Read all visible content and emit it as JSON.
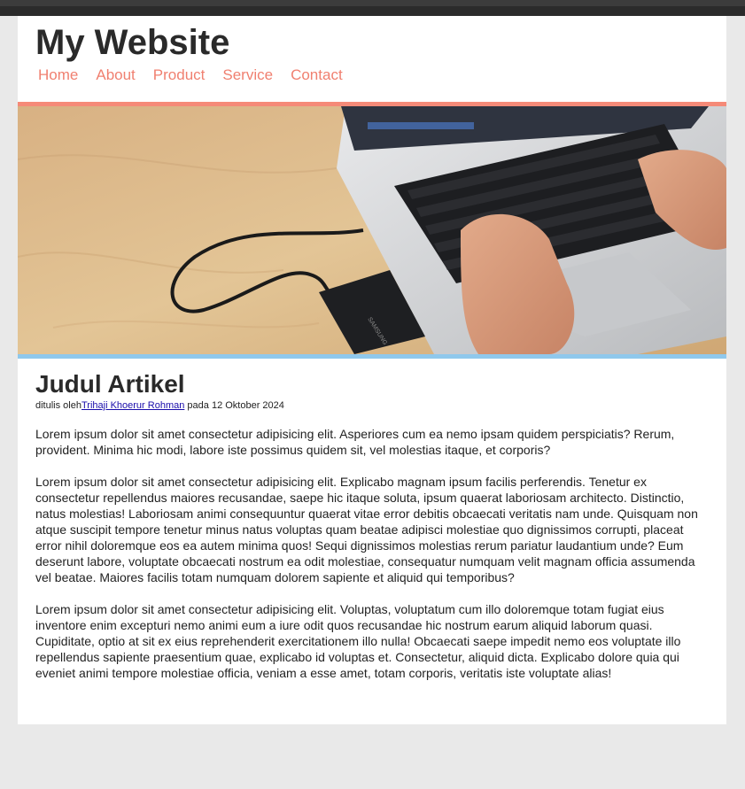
{
  "site": {
    "title": "My Website",
    "nav": [
      "Home",
      "About",
      "Product",
      "Service",
      "Contact"
    ]
  },
  "hero": {
    "image_alt": "Laptop with external drive on wooden desk",
    "device_label": "SAMSUNG"
  },
  "article": {
    "title": "Judul Artikel",
    "byline_prefix": "ditulis oleh",
    "author": "Trihaji Khoerur Rohman",
    "byline_mid": " pada ",
    "date": "12 Oktober 2024",
    "paragraphs": [
      "Lorem ipsum dolor sit amet consectetur adipisicing elit. Asperiores cum ea nemo ipsam quidem perspiciatis? Rerum, provident. Minima hic modi, labore iste possimus quidem sit, vel molestias itaque, et corporis?",
      "Lorem ipsum dolor sit amet consectetur adipisicing elit. Explicabo magnam ipsum facilis perferendis. Tenetur ex consectetur repellendus maiores recusandae, saepe hic itaque soluta, ipsum quaerat laboriosam architecto. Distinctio, natus molestias! Laboriosam animi consequuntur quaerat vitae error debitis obcaecati veritatis nam unde. Quisquam non atque suscipit tempore tenetur minus natus voluptas quam beatae adipisci molestiae quo dignissimos corrupti, placeat error nihil doloremque eos ea autem minima quos! Sequi dignissimos molestias rerum pariatur laudantium unde? Eum deserunt labore, voluptate obcaecati nostrum ea odit molestiae, consequatur numquam velit magnam officia assumenda vel beatae. Maiores facilis totam numquam dolorem sapiente et aliquid qui temporibus?",
      "Lorem ipsum dolor sit amet consectetur adipisicing elit. Voluptas, voluptatum cum illo doloremque totam fugiat eius inventore enim excepturi nemo animi eum a iure odit quos recusandae hic nostrum earum aliquid laborum quasi. Cupiditate, optio at sit ex eius reprehenderit exercitationem illo nulla! Obcaecati saepe impedit nemo eos voluptate illo repellendus sapiente praesentium quae, explicabo id voluptas et. Consectetur, aliquid dicta. Explicabo dolore quia qui eveniet animi tempore molestiae officia, veniam a esse amet, totam corporis, veritatis iste voluptate alias!"
    ]
  },
  "colors": {
    "nav_link": "#f08070",
    "accent_top": "#f58a78",
    "accent_bottom": "#8fc8ec",
    "background": "#e9e9e9"
  }
}
